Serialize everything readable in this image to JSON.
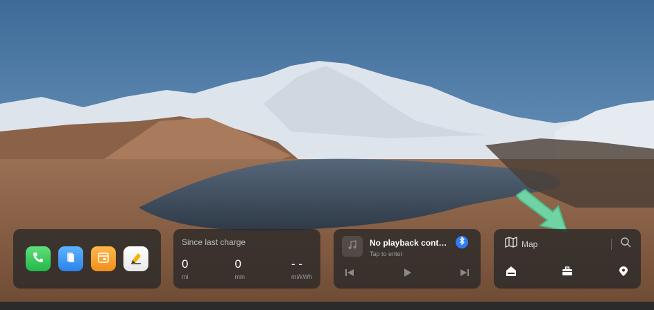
{
  "colors": {
    "accent_green": "#6fd3a3",
    "bluetooth": "#2f7df2"
  },
  "dock": {
    "apps": [
      {
        "icon": "phone-icon"
      },
      {
        "icon": "files-icon"
      },
      {
        "icon": "calendar-icon"
      },
      {
        "icon": "notes-icon"
      }
    ]
  },
  "charge": {
    "title": "Since last charge",
    "stats": [
      {
        "value": "0",
        "unit": "mi"
      },
      {
        "value": "0",
        "unit": "min"
      },
      {
        "value": "- -",
        "unit": "mi/kWh"
      }
    ]
  },
  "media": {
    "title": "No playback cont…",
    "subtitle": "Tap to enter",
    "icons": [
      "music-note-icon",
      "bluetooth-icon",
      "previous-icon",
      "play-icon",
      "next-icon"
    ]
  },
  "map": {
    "label": "Map",
    "icons": [
      "map-icon",
      "search-icon",
      "home-icon",
      "work-icon",
      "location-pin-icon"
    ]
  }
}
